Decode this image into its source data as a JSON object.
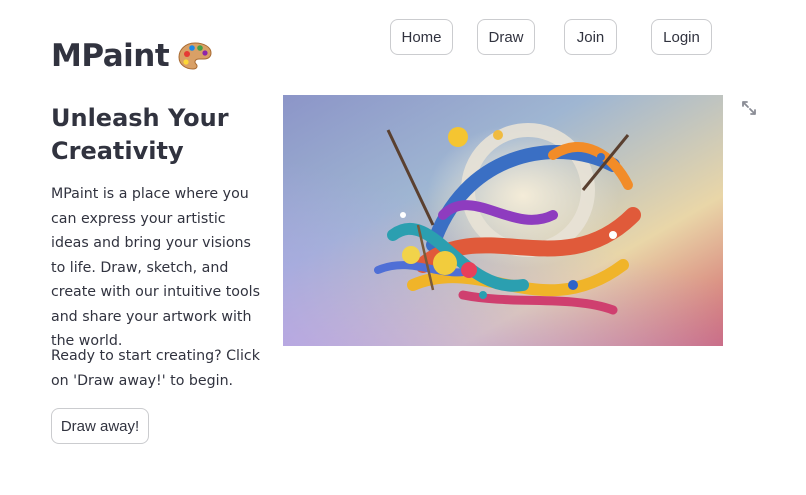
{
  "nav": {
    "home_label": "Home",
    "draw_label": "Draw",
    "join_label": "Join",
    "login_label": "Login"
  },
  "header": {
    "app_title": "MPaint",
    "title_icon": "palette-icon"
  },
  "main": {
    "headline": "Unleash Your Creativity",
    "paragraph1": "MPaint is a place where you can express your artistic ideas and bring your visions to life. Draw, sketch, and create with our intuitive tools and share your artwork with the world.",
    "paragraph2": "Ready to start creating? Click on 'Draw away!' to begin.",
    "cta_label": "Draw away!"
  },
  "hero": {
    "icon": "fullscreen-expand-icon"
  },
  "colors": {
    "text": "#31333f",
    "border": "#d0d1d4",
    "background": "#ffffff"
  }
}
